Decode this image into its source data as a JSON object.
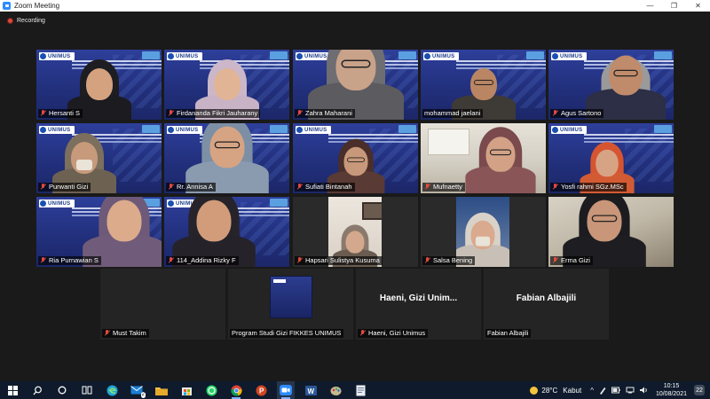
{
  "window": {
    "title": "Zoom Meeting",
    "controls": [
      "—",
      "❐",
      "✕"
    ]
  },
  "status": {
    "recording": "Recording"
  },
  "participants": [
    {
      "name": "Hersanti S",
      "muted": true
    },
    {
      "name": "Firdananda Fikri Jauharany",
      "muted": true
    },
    {
      "name": "Zahra Maharani",
      "muted": true
    },
    {
      "name": "mohammad jaelani",
      "muted": false
    },
    {
      "name": "Agus Sartono",
      "muted": true
    },
    {
      "name": "Purwanti Gizi",
      "muted": true
    },
    {
      "name": "Rr. Annisa A",
      "muted": true,
      "active_speaker": true
    },
    {
      "name": "Sufiati Bintanah",
      "muted": true
    },
    {
      "name": "Mufnaetty",
      "muted": true
    },
    {
      "name": "Yosfi rahmi SGz.MSc",
      "muted": true
    },
    {
      "name": "Ria Purnawian S",
      "muted": true
    },
    {
      "name": "114_Addina Rizky F",
      "muted": true
    },
    {
      "name": "Hapsari Sulistya Kusuma",
      "muted": true
    },
    {
      "name": "Salsa Bening",
      "muted": true
    },
    {
      "name": "Erma Gizi",
      "muted": true
    },
    {
      "name": "Must Takim",
      "muted": true
    },
    {
      "name": "Program Studi Gizi FIKKES UNIMUS",
      "muted": false
    },
    {
      "name": "Haeni, Gizi Unimus",
      "muted": true,
      "avatar_text": "Haeni, Gizi Unim..."
    },
    {
      "name": "Fabian Albajili",
      "muted": false,
      "avatar_text": "Fabian Albajili"
    }
  ],
  "slide_logo": "UNIMUS",
  "taskbar": {
    "apps": [
      "start",
      "search",
      "task-view",
      "widgets",
      "edge",
      "mail",
      "file-explorer",
      "store",
      "whatsapp",
      "chrome",
      "powerpoint",
      "zoom",
      "word",
      "paint",
      "files"
    ],
    "mail_badge": "2",
    "weather": {
      "temp": "28°C",
      "condition": "Kabut"
    },
    "time": "10:15",
    "date": "10/08/2021",
    "notifications": "22"
  }
}
